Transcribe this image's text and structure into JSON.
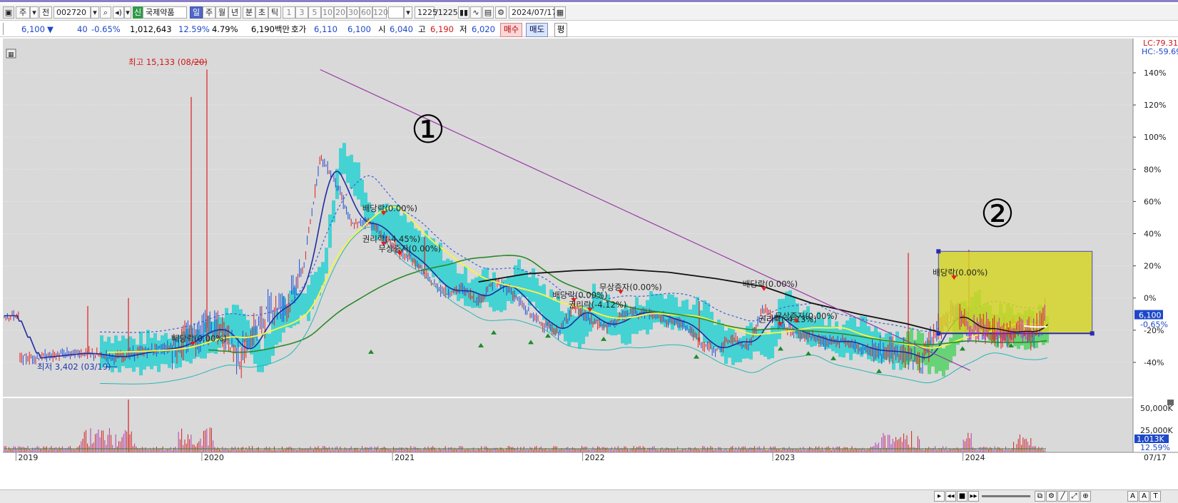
{
  "toolbar": {
    "period_main": "주",
    "all_label": "전",
    "code": "002720",
    "new_badge": "신",
    "stock_name": "국제약품",
    "periods": [
      "일",
      "주",
      "월",
      "년",
      "분",
      "초",
      "틱"
    ],
    "minutes": [
      "1",
      "3",
      "5",
      "10",
      "20",
      "30",
      "60",
      "120"
    ],
    "count": "1225",
    "count_total": "/1225",
    "date": "2024/07/17"
  },
  "quote": {
    "price": "6,100",
    "change": "40",
    "change_pct": "-0.65%",
    "volume": "1,012,643",
    "turnover_pct": "12.59%",
    "ratio_pct": "4.79%",
    "amount": "6,190백만",
    "ask_label": "호가",
    "ask": "6,110",
    "bid": "6,100",
    "open_label": "시",
    "open": "6,040",
    "high_label": "고",
    "high": "6,190",
    "low_label": "저",
    "low": "6,020",
    "buy": "매수",
    "sell": "매도",
    "avg": "평"
  },
  "chart_data": {
    "type": "line",
    "indicator_labels": [
      "LC:79.31",
      "HC:-59.69"
    ],
    "y_ticks": [
      "140%",
      "120%",
      "100%",
      "80%",
      "60%",
      "40%",
      "20%",
      "0%",
      "-20%",
      "-40%"
    ],
    "x_labels": [
      "2019",
      "2020",
      "2021",
      "2022",
      "2023",
      "2024",
      "07/17"
    ],
    "volume_ticks": [
      "50,000K",
      "25,000K",
      "0K"
    ],
    "volume_current": "1,013K",
    "turnover_current": "12.59%",
    "price_current": "6,100",
    "price_change_current": "-0.65%",
    "high_marker": "최고 15,133 (08/20)",
    "low_marker": "최저 3,402 (03/19)",
    "circle_1": "①",
    "circle_2": "②",
    "annotations": [
      {
        "text": "배당락(0.00%)",
        "date": "2019-12",
        "y": -27
      },
      {
        "text": "배당락(0.00%)",
        "date": "2020-12",
        "y": 54
      },
      {
        "text": "권리락(-4.45%)",
        "date": "2020-12",
        "y": 35
      },
      {
        "text": "무상증자(0.00%)",
        "date": "2021-01",
        "y": 29
      },
      {
        "text": "배당락(0.00%)",
        "date": "2021-12",
        "y": 0
      },
      {
        "text": "무상증자(0.00%)",
        "date": "2022-03",
        "y": 5
      },
      {
        "text": "권리락(-4.12%)",
        "date": "2022-01",
        "y": -6
      },
      {
        "text": "배당락(0.00%)",
        "date": "2022-12",
        "y": 7
      },
      {
        "text": "권리락(-4.13%)",
        "date": "2023-01",
        "y": -15
      },
      {
        "text": "무상증자(0.00%)",
        "date": "2023-02",
        "y": -13
      },
      {
        "text": "배당락(0.00%)",
        "date": "2023-12",
        "y": 14
      }
    ],
    "price_series": [
      [
        "2019-01",
        -38
      ],
      [
        "2019-03",
        -36
      ],
      [
        "2019-05",
        -34
      ],
      [
        "2019-07",
        -37
      ],
      [
        "2019-09",
        -33
      ],
      [
        "2019-11",
        -30
      ],
      [
        "2020-01",
        -18
      ],
      [
        "2020-02",
        -22
      ],
      [
        "2020-03",
        -38
      ],
      [
        "2020-04",
        -18
      ],
      [
        "2020-05",
        -6
      ],
      [
        "2020-06",
        -3
      ],
      [
        "2020-07",
        20
      ],
      [
        "2020-08",
        88
      ],
      [
        "2020-09",
        72
      ],
      [
        "2020-10",
        45
      ],
      [
        "2020-11",
        48
      ],
      [
        "2020-12",
        38
      ],
      [
        "2021-01",
        28
      ],
      [
        "2021-02",
        22
      ],
      [
        "2021-03",
        10
      ],
      [
        "2021-04",
        3
      ],
      [
        "2021-05",
        6
      ],
      [
        "2021-06",
        -2
      ],
      [
        "2021-07",
        10
      ],
      [
        "2021-08",
        5
      ],
      [
        "2021-09",
        -8
      ],
      [
        "2021-10",
        -16
      ],
      [
        "2021-11",
        -22
      ],
      [
        "2021-12",
        -5
      ],
      [
        "2022-01",
        -14
      ],
      [
        "2022-02",
        -18
      ],
      [
        "2022-03",
        -12
      ],
      [
        "2022-04",
        -8
      ],
      [
        "2022-05",
        -10
      ],
      [
        "2022-06",
        -14
      ],
      [
        "2022-07",
        -16
      ],
      [
        "2022-08",
        -28
      ],
      [
        "2022-09",
        -33
      ],
      [
        "2022-10",
        -25
      ],
      [
        "2022-11",
        -30
      ],
      [
        "2022-12",
        -6
      ],
      [
        "2023-01",
        -17
      ],
      [
        "2023-02",
        -22
      ],
      [
        "2023-03",
        -24
      ],
      [
        "2023-04",
        -28
      ],
      [
        "2023-05",
        -26
      ],
      [
        "2023-06",
        -31
      ],
      [
        "2023-07",
        -33
      ],
      [
        "2023-08",
        -33
      ],
      [
        "2023-09",
        -35
      ],
      [
        "2023-10",
        -40
      ],
      [
        "2023-11",
        -18
      ],
      [
        "2023-12",
        -8
      ],
      [
        "2024-01",
        -20
      ],
      [
        "2024-02",
        -18
      ],
      [
        "2024-03",
        -22
      ],
      [
        "2024-04",
        -20
      ],
      [
        "2024-05",
        -22
      ],
      [
        "2024-06",
        -6
      ],
      [
        "2024-07",
        -11
      ]
    ],
    "ma_long": [
      [
        "2021-06",
        10
      ],
      [
        "2021-09",
        15
      ],
      [
        "2021-12",
        17
      ],
      [
        "2022-03",
        18
      ],
      [
        "2022-06",
        16
      ],
      [
        "2022-09",
        12
      ],
      [
        "2022-12",
        7
      ],
      [
        "2023-03",
        -3
      ],
      [
        "2023-06",
        -10
      ],
      [
        "2023-09",
        -16
      ],
      [
        "2023-11",
        -21
      ]
    ],
    "trendline": {
      "from": [
        "2020-08",
        142
      ],
      "to": [
        "2024-01",
        -45
      ]
    },
    "box": {
      "from": [
        "2023-11",
        29
      ],
      "to": [
        "2024-07",
        -22
      ]
    }
  },
  "bottom": {
    "buttons": [
      "▸",
      "◂◂",
      "■",
      "▸▸"
    ],
    "tools": [
      "A",
      "A",
      "T"
    ]
  },
  "colors": {
    "bg": "#d9d9d9",
    "candle_up": "#e11d1d",
    "candle_down": "#1d4fd8",
    "ma_short": "#1f2d9f",
    "ma_mid": "#f3f34a",
    "ma_120": "#2a8a2a",
    "ma_long": "#111111",
    "cloud": "#34d0d0",
    "trendline": "#9a3aa8",
    "box": "#d6d624"
  }
}
